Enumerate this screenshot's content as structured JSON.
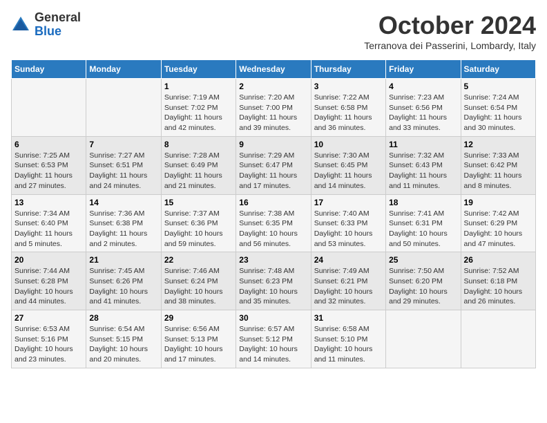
{
  "logo": {
    "general": "General",
    "blue": "Blue"
  },
  "title": "October 2024",
  "location": "Terranova dei Passerini, Lombardy, Italy",
  "days_header": [
    "Sunday",
    "Monday",
    "Tuesday",
    "Wednesday",
    "Thursday",
    "Friday",
    "Saturday"
  ],
  "weeks": [
    [
      {
        "day": "",
        "info": ""
      },
      {
        "day": "",
        "info": ""
      },
      {
        "day": "1",
        "info": "Sunrise: 7:19 AM\nSunset: 7:02 PM\nDaylight: 11 hours and 42 minutes."
      },
      {
        "day": "2",
        "info": "Sunrise: 7:20 AM\nSunset: 7:00 PM\nDaylight: 11 hours and 39 minutes."
      },
      {
        "day": "3",
        "info": "Sunrise: 7:22 AM\nSunset: 6:58 PM\nDaylight: 11 hours and 36 minutes."
      },
      {
        "day": "4",
        "info": "Sunrise: 7:23 AM\nSunset: 6:56 PM\nDaylight: 11 hours and 33 minutes."
      },
      {
        "day": "5",
        "info": "Sunrise: 7:24 AM\nSunset: 6:54 PM\nDaylight: 11 hours and 30 minutes."
      }
    ],
    [
      {
        "day": "6",
        "info": "Sunrise: 7:25 AM\nSunset: 6:53 PM\nDaylight: 11 hours and 27 minutes."
      },
      {
        "day": "7",
        "info": "Sunrise: 7:27 AM\nSunset: 6:51 PM\nDaylight: 11 hours and 24 minutes."
      },
      {
        "day": "8",
        "info": "Sunrise: 7:28 AM\nSunset: 6:49 PM\nDaylight: 11 hours and 21 minutes."
      },
      {
        "day": "9",
        "info": "Sunrise: 7:29 AM\nSunset: 6:47 PM\nDaylight: 11 hours and 17 minutes."
      },
      {
        "day": "10",
        "info": "Sunrise: 7:30 AM\nSunset: 6:45 PM\nDaylight: 11 hours and 14 minutes."
      },
      {
        "day": "11",
        "info": "Sunrise: 7:32 AM\nSunset: 6:43 PM\nDaylight: 11 hours and 11 minutes."
      },
      {
        "day": "12",
        "info": "Sunrise: 7:33 AM\nSunset: 6:42 PM\nDaylight: 11 hours and 8 minutes."
      }
    ],
    [
      {
        "day": "13",
        "info": "Sunrise: 7:34 AM\nSunset: 6:40 PM\nDaylight: 11 hours and 5 minutes."
      },
      {
        "day": "14",
        "info": "Sunrise: 7:36 AM\nSunset: 6:38 PM\nDaylight: 11 hours and 2 minutes."
      },
      {
        "day": "15",
        "info": "Sunrise: 7:37 AM\nSunset: 6:36 PM\nDaylight: 10 hours and 59 minutes."
      },
      {
        "day": "16",
        "info": "Sunrise: 7:38 AM\nSunset: 6:35 PM\nDaylight: 10 hours and 56 minutes."
      },
      {
        "day": "17",
        "info": "Sunrise: 7:40 AM\nSunset: 6:33 PM\nDaylight: 10 hours and 53 minutes."
      },
      {
        "day": "18",
        "info": "Sunrise: 7:41 AM\nSunset: 6:31 PM\nDaylight: 10 hours and 50 minutes."
      },
      {
        "day": "19",
        "info": "Sunrise: 7:42 AM\nSunset: 6:29 PM\nDaylight: 10 hours and 47 minutes."
      }
    ],
    [
      {
        "day": "20",
        "info": "Sunrise: 7:44 AM\nSunset: 6:28 PM\nDaylight: 10 hours and 44 minutes."
      },
      {
        "day": "21",
        "info": "Sunrise: 7:45 AM\nSunset: 6:26 PM\nDaylight: 10 hours and 41 minutes."
      },
      {
        "day": "22",
        "info": "Sunrise: 7:46 AM\nSunset: 6:24 PM\nDaylight: 10 hours and 38 minutes."
      },
      {
        "day": "23",
        "info": "Sunrise: 7:48 AM\nSunset: 6:23 PM\nDaylight: 10 hours and 35 minutes."
      },
      {
        "day": "24",
        "info": "Sunrise: 7:49 AM\nSunset: 6:21 PM\nDaylight: 10 hours and 32 minutes."
      },
      {
        "day": "25",
        "info": "Sunrise: 7:50 AM\nSunset: 6:20 PM\nDaylight: 10 hours and 29 minutes."
      },
      {
        "day": "26",
        "info": "Sunrise: 7:52 AM\nSunset: 6:18 PM\nDaylight: 10 hours and 26 minutes."
      }
    ],
    [
      {
        "day": "27",
        "info": "Sunrise: 6:53 AM\nSunset: 5:16 PM\nDaylight: 10 hours and 23 minutes."
      },
      {
        "day": "28",
        "info": "Sunrise: 6:54 AM\nSunset: 5:15 PM\nDaylight: 10 hours and 20 minutes."
      },
      {
        "day": "29",
        "info": "Sunrise: 6:56 AM\nSunset: 5:13 PM\nDaylight: 10 hours and 17 minutes."
      },
      {
        "day": "30",
        "info": "Sunrise: 6:57 AM\nSunset: 5:12 PM\nDaylight: 10 hours and 14 minutes."
      },
      {
        "day": "31",
        "info": "Sunrise: 6:58 AM\nSunset: 5:10 PM\nDaylight: 10 hours and 11 minutes."
      },
      {
        "day": "",
        "info": ""
      },
      {
        "day": "",
        "info": ""
      }
    ]
  ]
}
